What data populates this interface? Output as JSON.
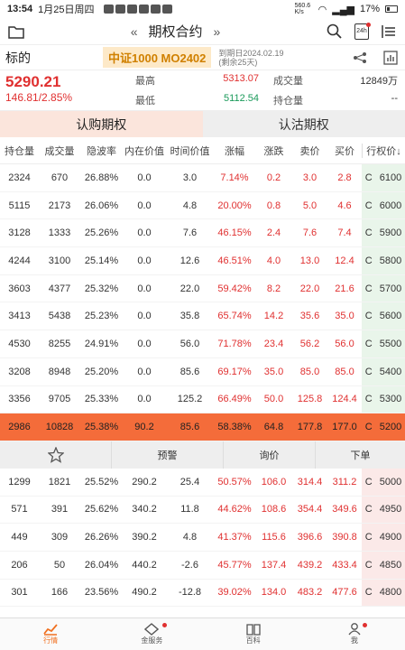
{
  "status": {
    "time": "13:54",
    "date": "1月25日周四",
    "net": "560.6 K/s",
    "battery": "17%"
  },
  "title": {
    "text": "期权合约",
    "prev": "«",
    "next": "»",
    "badge": "24h"
  },
  "instrument": {
    "name": "标的",
    "code": "中证1000 MO2402",
    "expiry_line1": "到期日2024.02.19",
    "expiry_line2": "(剩余25天)"
  },
  "quote": {
    "price": "5290.21",
    "change": "146.81/2.85%",
    "high_label": "最高",
    "high": "5313.07",
    "low_label": "最低",
    "low": "5112.54",
    "vol_label": "成交量",
    "vol": "12849万",
    "oi_label": "持仓量",
    "oi": "--"
  },
  "tabs": [
    "认购期权",
    "认沽期权"
  ],
  "columns": [
    "持仓量",
    "成交量",
    "隐波率",
    "内在价值",
    "时间价值",
    "涨幅",
    "涨跌",
    "卖价",
    "买价",
    "行权价↓"
  ],
  "rows_top": [
    [
      "2324",
      "670",
      "26.88%",
      "0.0",
      "3.0",
      "7.14%",
      "0.2",
      "3.0",
      "2.8",
      "C",
      "6100"
    ],
    [
      "5115",
      "2173",
      "26.06%",
      "0.0",
      "4.8",
      "20.00%",
      "0.8",
      "5.0",
      "4.6",
      "C",
      "6000"
    ],
    [
      "3128",
      "1333",
      "25.26%",
      "0.0",
      "7.6",
      "46.15%",
      "2.4",
      "7.6",
      "7.4",
      "C",
      "5900"
    ],
    [
      "4244",
      "3100",
      "25.14%",
      "0.0",
      "12.6",
      "46.51%",
      "4.0",
      "13.0",
      "12.4",
      "C",
      "5800"
    ],
    [
      "3603",
      "4377",
      "25.32%",
      "0.0",
      "22.0",
      "59.42%",
      "8.2",
      "22.0",
      "21.6",
      "C",
      "5700"
    ],
    [
      "3413",
      "5438",
      "25.23%",
      "0.0",
      "35.8",
      "65.74%",
      "14.2",
      "35.6",
      "35.0",
      "C",
      "5600"
    ],
    [
      "4530",
      "8255",
      "24.91%",
      "0.0",
      "56.0",
      "71.78%",
      "23.4",
      "56.2",
      "56.0",
      "C",
      "5500"
    ],
    [
      "3208",
      "8948",
      "25.20%",
      "0.0",
      "85.6",
      "69.17%",
      "35.0",
      "85.0",
      "85.0",
      "C",
      "5400"
    ],
    [
      "3356",
      "9705",
      "25.33%",
      "0.0",
      "125.2",
      "66.49%",
      "50.0",
      "125.8",
      "124.4",
      "C",
      "5300"
    ]
  ],
  "row_selected": [
    "2986",
    "10828",
    "25.38%",
    "90.2",
    "85.6",
    "58.38%",
    "64.8",
    "177.8",
    "177.0",
    "C",
    "5200"
  ],
  "actions": {
    "alert": "预警",
    "inquiry": "询价",
    "order": "下单"
  },
  "rows_bottom": [
    [
      "1299",
      "1821",
      "25.52%",
      "290.2",
      "25.4",
      "50.57%",
      "106.0",
      "314.4",
      "311.2",
      "C",
      "5000"
    ],
    [
      "571",
      "391",
      "25.62%",
      "340.2",
      "11.8",
      "44.62%",
      "108.6",
      "354.4",
      "349.6",
      "C",
      "4950"
    ],
    [
      "449",
      "309",
      "26.26%",
      "390.2",
      "4.8",
      "41.37%",
      "115.6",
      "396.6",
      "390.8",
      "C",
      "4900"
    ],
    [
      "206",
      "50",
      "26.04%",
      "440.2",
      "-2.6",
      "45.77%",
      "137.4",
      "439.2",
      "433.4",
      "C",
      "4850"
    ],
    [
      "301",
      "166",
      "23.56%",
      "490.2",
      "-12.8",
      "39.02%",
      "134.0",
      "483.2",
      "477.6",
      "C",
      "4800"
    ]
  ],
  "nav": [
    "行情",
    "金服务",
    "百科",
    "我"
  ],
  "colors": {
    "up": "#e03030",
    "down": "#1a9a5a",
    "highlight": "#f46c3a",
    "accent": "#f07020"
  }
}
